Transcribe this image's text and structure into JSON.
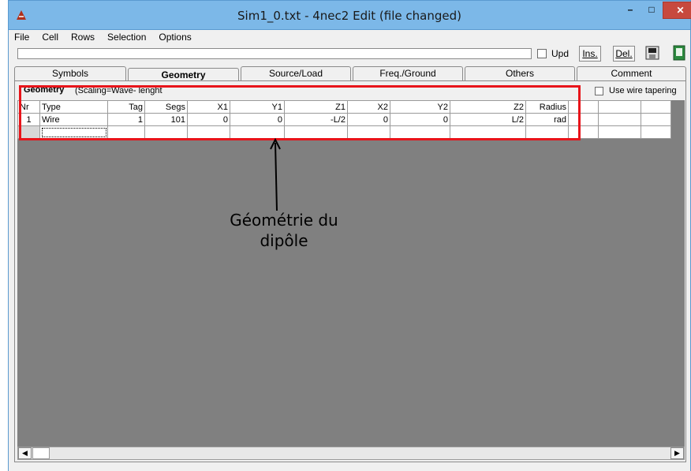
{
  "window": {
    "title": "Sim1_0.txt - 4nec2 Edit (file changed)",
    "minimize_label": "–",
    "maximize_label": "□",
    "close_label": "✕"
  },
  "menu": [
    "File",
    "Cell",
    "Rows",
    "Selection",
    "Options"
  ],
  "toolbar": {
    "edit_value": "",
    "upd_label": "Upd",
    "upd_checked": false,
    "ins_label": "Ins.",
    "del_label": "Del.",
    "icons": [
      "copy-icon",
      "save-icon"
    ]
  },
  "tabs": [
    {
      "label": "Symbols",
      "active": false
    },
    {
      "label": "Geometry",
      "active": true
    },
    {
      "label": "Source/Load",
      "active": false
    },
    {
      "label": "Freq./Ground",
      "active": false
    },
    {
      "label": "Others",
      "active": false
    },
    {
      "label": "Comment",
      "active": false
    }
  ],
  "geometry": {
    "heading": "Geometry",
    "scaling": "(Scaling=Wave- lenght",
    "taper_label": "Use wire tapering",
    "taper_checked": false,
    "columns": [
      "Nr",
      "Type",
      "Tag",
      "Segs",
      "X1",
      "Y1",
      "Z1",
      "X2",
      "Y2",
      "Z2",
      "Radius"
    ],
    "rows": [
      {
        "nr": "1",
        "type": "Wire",
        "tag": "1",
        "segs": "101",
        "x1": "0",
        "y1": "0",
        "z1": "-L/2",
        "x2": "0",
        "y2": "0",
        "z2": "L/2",
        "radius": "rad"
      }
    ]
  },
  "annotation": {
    "line1": "Géométrie du",
    "line2": "dipôle",
    "highlight_color": "#e8141a"
  },
  "colors": {
    "titlebar": "#7cb8e8",
    "close_button": "#c7493e",
    "empty_grid": "#808080"
  }
}
